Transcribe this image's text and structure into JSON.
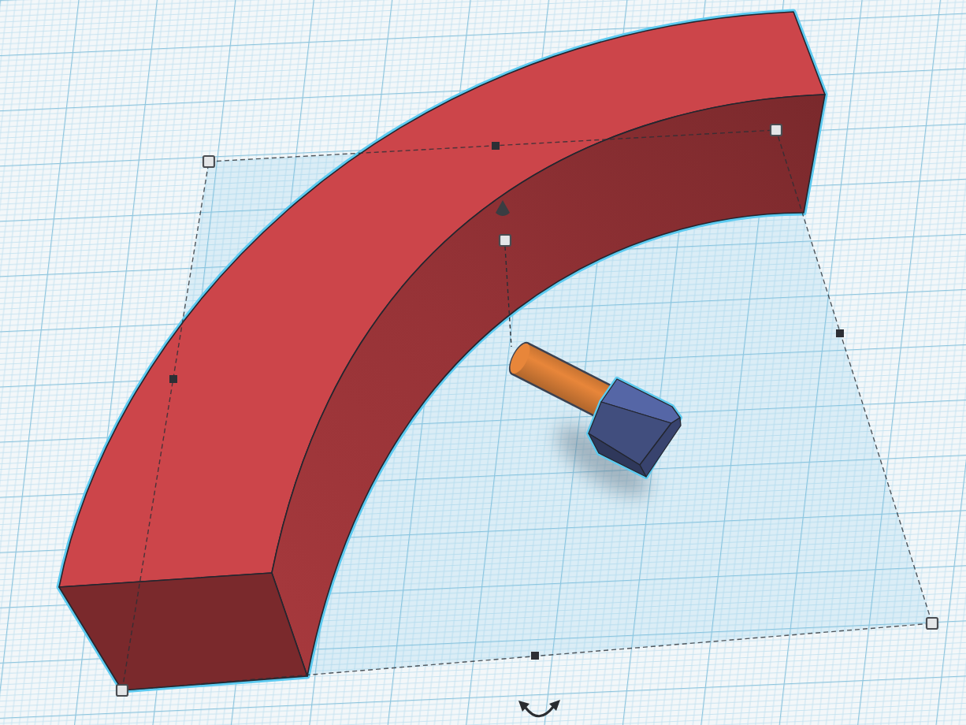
{
  "workplane": {
    "shapes": [
      {
        "kind": "curved-wall",
        "color": "#cc454a",
        "selected": true
      },
      {
        "kind": "cylinder",
        "color": "#e8863a",
        "selected": false
      },
      {
        "kind": "hexagonal-prism",
        "color": "#5566a6",
        "selected": true
      }
    ]
  }
}
